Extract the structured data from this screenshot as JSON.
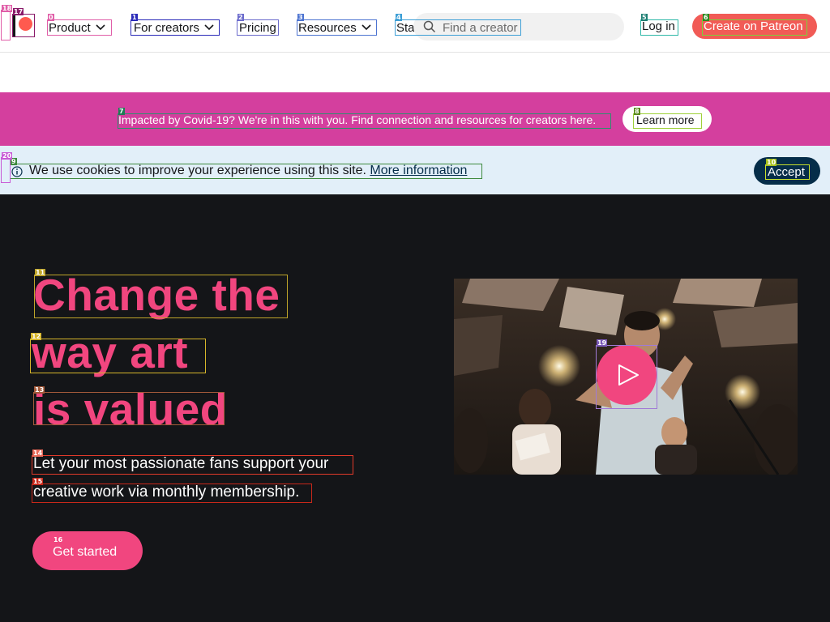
{
  "header": {
    "nav": [
      "Product",
      "For creators",
      "Pricing",
      "Resources",
      "Sta"
    ],
    "search_placeholder": "Find a creator",
    "login_label": "Log in",
    "cta_label": "Create on Patreon"
  },
  "banner": {
    "text": "Impacted by Covid-19? We're in this with you. Find connection and resources for creators here.",
    "button_label": "Learn more"
  },
  "cookie": {
    "text": "We use cookies to improve your experience using this site.",
    "link_label": "More information",
    "accept_label": "Accept"
  },
  "hero": {
    "headline": [
      "Change the",
      "way art",
      "is valued"
    ],
    "subtitle": [
      "Let your most passionate fans support your",
      "creative work via monthly membership."
    ],
    "cta_label": "Get started"
  },
  "markers": [
    "0",
    "1",
    "2",
    "3",
    "4",
    "5",
    "6",
    "7",
    "8",
    "9",
    "10",
    "11",
    "12",
    "13",
    "14",
    "15",
    "16",
    "17",
    "18",
    "19",
    "20"
  ],
  "colors": {
    "brand_coral": "#f15b56",
    "banner_magenta": "#d43f9e",
    "hero_bg": "#141518",
    "hero_pink": "#f1467f",
    "cookie_bg": "#e2eff9",
    "accept_navy": "#052d49"
  }
}
